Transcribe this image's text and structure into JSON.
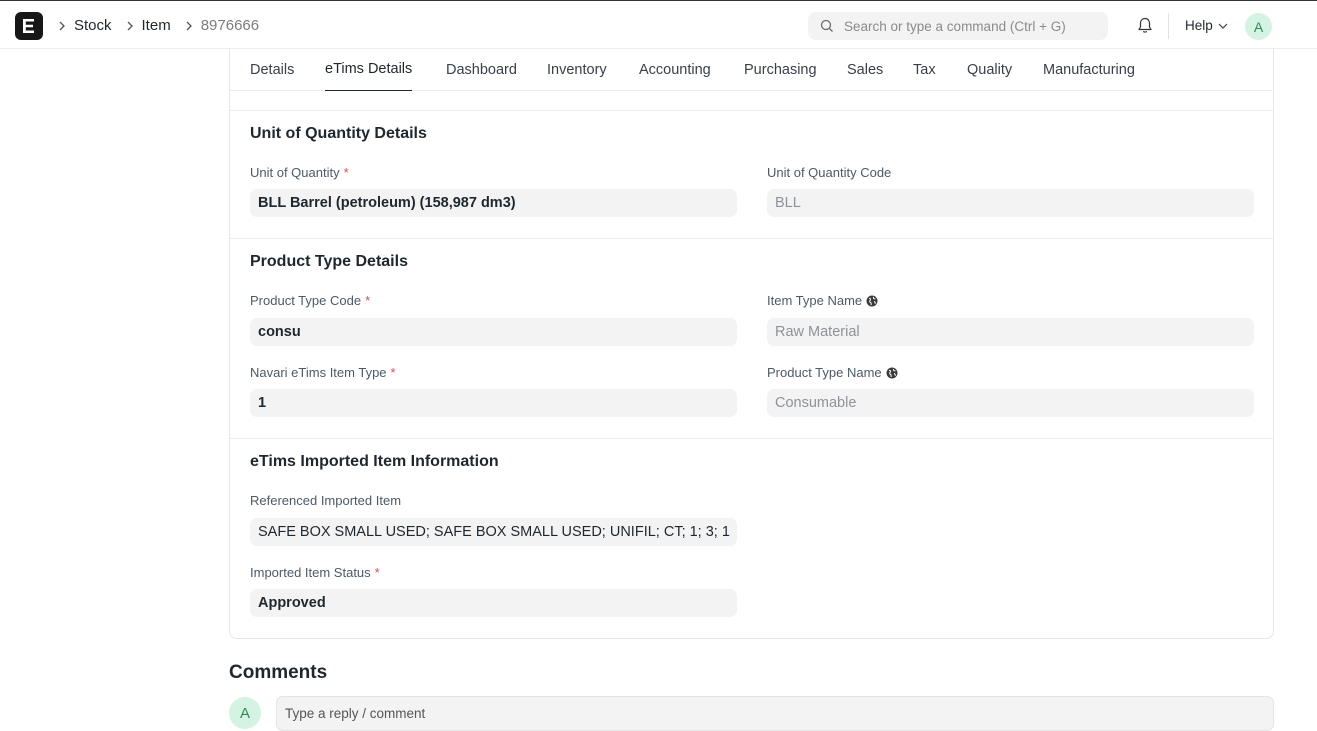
{
  "breadcrumb": [
    {
      "label": "Stock"
    },
    {
      "label": "Item"
    }
  ],
  "breadcrumb_current": "8976666",
  "search": {
    "placeholder": "Search or type a command (Ctrl + G)"
  },
  "help_label": "Help",
  "user_initial": "A",
  "tabs": [
    "Details",
    "eTims Details",
    "Dashboard",
    "Inventory",
    "Accounting",
    "Purchasing",
    "Sales",
    "Tax",
    "Quality",
    "Manufacturing"
  ],
  "active_tab": "eTims Details",
  "sections": {
    "uoq": {
      "title": "Unit of Quantity Details",
      "unit_label": "Unit of Quantity",
      "unit_value": "BLL Barrel (petroleum) (158,987 dm3)",
      "code_label": "Unit of Quantity Code",
      "code_value": "BLL"
    },
    "product_type": {
      "title": "Product Type Details",
      "code_label": "Product Type Code",
      "code_value": "consu",
      "item_type_label": "Item Type Name",
      "item_type_value": "Raw Material",
      "navari_label": "Navari eTims Item Type",
      "navari_value": "1",
      "product_type_label": "Product Type Name",
      "product_type_value": "Consumable"
    },
    "imported": {
      "title": "eTims Imported Item Information",
      "ref_label": "Referenced Imported Item",
      "ref_value": "SAFE BOX SMALL USED; SAFE BOX SMALL USED; UNIFIL; CT; 1; 3; 1",
      "status_label": "Imported Item Status",
      "status_value": "Approved"
    }
  },
  "comments": {
    "title": "Comments",
    "placeholder": "Type a reply / comment"
  },
  "colors": {
    "required": "#e24c4c",
    "avatar_bg": "#d5f3e2",
    "avatar_fg": "#318a57",
    "field_bg": "#f3f3f3"
  }
}
